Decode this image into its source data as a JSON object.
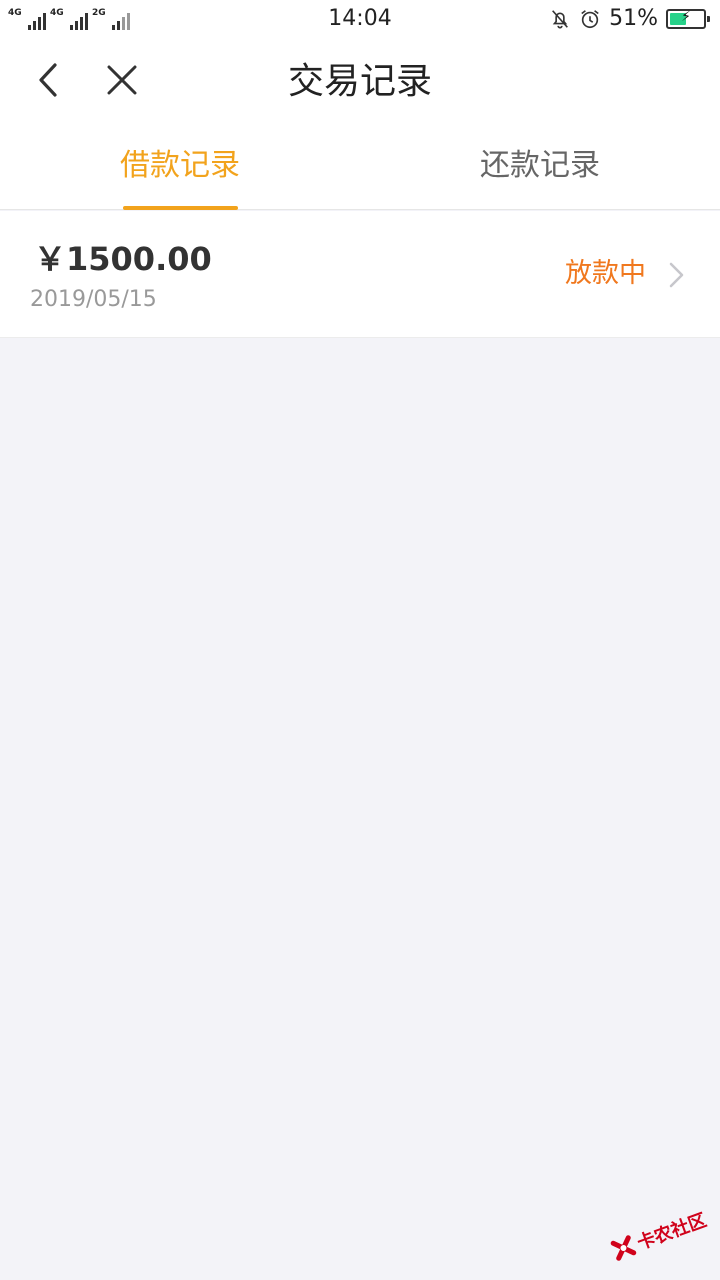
{
  "status_bar": {
    "network_1": "4G",
    "network_2": "4G",
    "network_3": "2G",
    "time": "14:04",
    "battery_percent": "51%",
    "battery_level": 0.51,
    "icons": [
      "mute-bell-icon",
      "alarm-clock-icon",
      "battery-charging-icon"
    ]
  },
  "nav": {
    "title": "交易记录",
    "back_icon": "chevron-left-icon",
    "close_icon": "close-icon"
  },
  "tabs": [
    {
      "label": "借款记录",
      "active": true
    },
    {
      "label": "还款记录",
      "active": false
    }
  ],
  "records": [
    {
      "amount": "￥1500.00",
      "date": "2019/05/15",
      "status": "放款中"
    }
  ],
  "watermark": {
    "text": "卡农社区"
  },
  "colors": {
    "accent": "#f2a31c",
    "status_orange": "#f0781e",
    "background": "#f3f3f8",
    "battery_green": "#27d28a"
  }
}
